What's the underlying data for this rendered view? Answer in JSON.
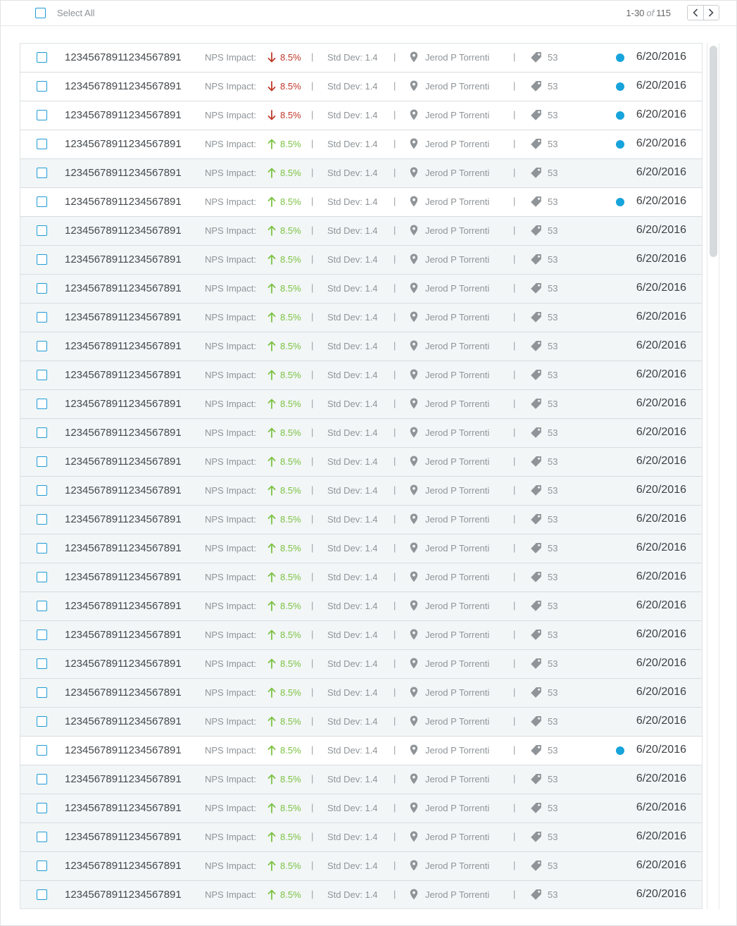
{
  "header": {
    "select_all_label": "Select All",
    "pager_range": "1-30",
    "pager_of": "of",
    "pager_total": "115"
  },
  "colors": {
    "accent": "#1f9bd6",
    "unread_dot": "#17a3db",
    "impact_up": "#7cc242",
    "impact_down": "#c0392b",
    "read_row_bg": "#f2f6f7",
    "unread_row_bg": "#ffffff"
  },
  "icons": {
    "impact_up": "arrow-up-icon",
    "impact_down": "arrow-down-icon",
    "owner": "location-pin-icon",
    "tags": "tag-icon",
    "unread": "unread-dot-icon",
    "prev": "chevron-left-icon",
    "next": "chevron-right-icon"
  },
  "rows": [
    {
      "id": "12345678911234567891",
      "nps_label": "NPS Impact:",
      "impact": "8.5%",
      "trend": "down",
      "std": "Std Dev: 1.4",
      "owner": "Jerod P Torrenti",
      "count": "53",
      "date": "6/20/2016",
      "unread": true
    },
    {
      "id": "12345678911234567891",
      "nps_label": "NPS Impact:",
      "impact": "8.5%",
      "trend": "down",
      "std": "Std Dev: 1.4",
      "owner": "Jerod P Torrenti",
      "count": "53",
      "date": "6/20/2016",
      "unread": true
    },
    {
      "id": "12345678911234567891",
      "nps_label": "NPS Impact:",
      "impact": "8.5%",
      "trend": "down",
      "std": "Std Dev: 1.4",
      "owner": "Jerod P Torrenti",
      "count": "53",
      "date": "6/20/2016",
      "unread": true
    },
    {
      "id": "12345678911234567891",
      "nps_label": "NPS Impact:",
      "impact": "8.5%",
      "trend": "up",
      "std": "Std Dev: 1.4",
      "owner": "Jerod P Torrenti",
      "count": "53",
      "date": "6/20/2016",
      "unread": true
    },
    {
      "id": "12345678911234567891",
      "nps_label": "NPS Impact:",
      "impact": "8.5%",
      "trend": "up",
      "std": "Std Dev: 1.4",
      "owner": "Jerod P Torrenti",
      "count": "53",
      "date": "6/20/2016",
      "unread": false
    },
    {
      "id": "12345678911234567891",
      "nps_label": "NPS Impact:",
      "impact": "8.5%",
      "trend": "up",
      "std": "Std Dev: 1.4",
      "owner": "Jerod P Torrenti",
      "count": "53",
      "date": "6/20/2016",
      "unread": true
    },
    {
      "id": "12345678911234567891",
      "nps_label": "NPS Impact:",
      "impact": "8.5%",
      "trend": "up",
      "std": "Std Dev: 1.4",
      "owner": "Jerod P Torrenti",
      "count": "53",
      "date": "6/20/2016",
      "unread": false
    },
    {
      "id": "12345678911234567891",
      "nps_label": "NPS Impact:",
      "impact": "8.5%",
      "trend": "up",
      "std": "Std Dev: 1.4",
      "owner": "Jerod P Torrenti",
      "count": "53",
      "date": "6/20/2016",
      "unread": false
    },
    {
      "id": "12345678911234567891",
      "nps_label": "NPS Impact:",
      "impact": "8.5%",
      "trend": "up",
      "std": "Std Dev: 1.4",
      "owner": "Jerod P Torrenti",
      "count": "53",
      "date": "6/20/2016",
      "unread": false
    },
    {
      "id": "12345678911234567891",
      "nps_label": "NPS Impact:",
      "impact": "8.5%",
      "trend": "up",
      "std": "Std Dev: 1.4",
      "owner": "Jerod P Torrenti",
      "count": "53",
      "date": "6/20/2016",
      "unread": false
    },
    {
      "id": "12345678911234567891",
      "nps_label": "NPS Impact:",
      "impact": "8.5%",
      "trend": "up",
      "std": "Std Dev: 1.4",
      "owner": "Jerod P Torrenti",
      "count": "53",
      "date": "6/20/2016",
      "unread": false
    },
    {
      "id": "12345678911234567891",
      "nps_label": "NPS Impact:",
      "impact": "8.5%",
      "trend": "up",
      "std": "Std Dev: 1.4",
      "owner": "Jerod P Torrenti",
      "count": "53",
      "date": "6/20/2016",
      "unread": false
    },
    {
      "id": "12345678911234567891",
      "nps_label": "NPS Impact:",
      "impact": "8.5%",
      "trend": "up",
      "std": "Std Dev: 1.4",
      "owner": "Jerod P Torrenti",
      "count": "53",
      "date": "6/20/2016",
      "unread": false
    },
    {
      "id": "12345678911234567891",
      "nps_label": "NPS Impact:",
      "impact": "8.5%",
      "trend": "up",
      "std": "Std Dev: 1.4",
      "owner": "Jerod P Torrenti",
      "count": "53",
      "date": "6/20/2016",
      "unread": false
    },
    {
      "id": "12345678911234567891",
      "nps_label": "NPS Impact:",
      "impact": "8.5%",
      "trend": "up",
      "std": "Std Dev: 1.4",
      "owner": "Jerod P Torrenti",
      "count": "53",
      "date": "6/20/2016",
      "unread": false
    },
    {
      "id": "12345678911234567891",
      "nps_label": "NPS Impact:",
      "impact": "8.5%",
      "trend": "up",
      "std": "Std Dev: 1.4",
      "owner": "Jerod P Torrenti",
      "count": "53",
      "date": "6/20/2016",
      "unread": false
    },
    {
      "id": "12345678911234567891",
      "nps_label": "NPS Impact:",
      "impact": "8.5%",
      "trend": "up",
      "std": "Std Dev: 1.4",
      "owner": "Jerod P Torrenti",
      "count": "53",
      "date": "6/20/2016",
      "unread": false
    },
    {
      "id": "12345678911234567891",
      "nps_label": "NPS Impact:",
      "impact": "8.5%",
      "trend": "up",
      "std": "Std Dev: 1.4",
      "owner": "Jerod P Torrenti",
      "count": "53",
      "date": "6/20/2016",
      "unread": false
    },
    {
      "id": "12345678911234567891",
      "nps_label": "NPS Impact:",
      "impact": "8.5%",
      "trend": "up",
      "std": "Std Dev: 1.4",
      "owner": "Jerod P Torrenti",
      "count": "53",
      "date": "6/20/2016",
      "unread": false
    },
    {
      "id": "12345678911234567891",
      "nps_label": "NPS Impact:",
      "impact": "8.5%",
      "trend": "up",
      "std": "Std Dev: 1.4",
      "owner": "Jerod P Torrenti",
      "count": "53",
      "date": "6/20/2016",
      "unread": false
    },
    {
      "id": "12345678911234567891",
      "nps_label": "NPS Impact:",
      "impact": "8.5%",
      "trend": "up",
      "std": "Std Dev: 1.4",
      "owner": "Jerod P Torrenti",
      "count": "53",
      "date": "6/20/2016",
      "unread": false
    },
    {
      "id": "12345678911234567891",
      "nps_label": "NPS Impact:",
      "impact": "8.5%",
      "trend": "up",
      "std": "Std Dev: 1.4",
      "owner": "Jerod P Torrenti",
      "count": "53",
      "date": "6/20/2016",
      "unread": false
    },
    {
      "id": "12345678911234567891",
      "nps_label": "NPS Impact:",
      "impact": "8.5%",
      "trend": "up",
      "std": "Std Dev: 1.4",
      "owner": "Jerod P Torrenti",
      "count": "53",
      "date": "6/20/2016",
      "unread": false
    },
    {
      "id": "12345678911234567891",
      "nps_label": "NPS Impact:",
      "impact": "8.5%",
      "trend": "up",
      "std": "Std Dev: 1.4",
      "owner": "Jerod P Torrenti",
      "count": "53",
      "date": "6/20/2016",
      "unread": false
    },
    {
      "id": "12345678911234567891",
      "nps_label": "NPS Impact:",
      "impact": "8.5%",
      "trend": "up",
      "std": "Std Dev: 1.4",
      "owner": "Jerod P Torrenti",
      "count": "53",
      "date": "6/20/2016",
      "unread": true
    },
    {
      "id": "12345678911234567891",
      "nps_label": "NPS Impact:",
      "impact": "8.5%",
      "trend": "up",
      "std": "Std Dev: 1.4",
      "owner": "Jerod P Torrenti",
      "count": "53",
      "date": "6/20/2016",
      "unread": false
    },
    {
      "id": "12345678911234567891",
      "nps_label": "NPS Impact:",
      "impact": "8.5%",
      "trend": "up",
      "std": "Std Dev: 1.4",
      "owner": "Jerod P Torrenti",
      "count": "53",
      "date": "6/20/2016",
      "unread": false
    },
    {
      "id": "12345678911234567891",
      "nps_label": "NPS Impact:",
      "impact": "8.5%",
      "trend": "up",
      "std": "Std Dev: 1.4",
      "owner": "Jerod P Torrenti",
      "count": "53",
      "date": "6/20/2016",
      "unread": false
    },
    {
      "id": "12345678911234567891",
      "nps_label": "NPS Impact:",
      "impact": "8.5%",
      "trend": "up",
      "std": "Std Dev: 1.4",
      "owner": "Jerod P Torrenti",
      "count": "53",
      "date": "6/20/2016",
      "unread": false
    },
    {
      "id": "12345678911234567891",
      "nps_label": "NPS Impact:",
      "impact": "8.5%",
      "trend": "up",
      "std": "Std Dev: 1.4",
      "owner": "Jerod P Torrenti",
      "count": "53",
      "date": "6/20/2016",
      "unread": false
    }
  ]
}
